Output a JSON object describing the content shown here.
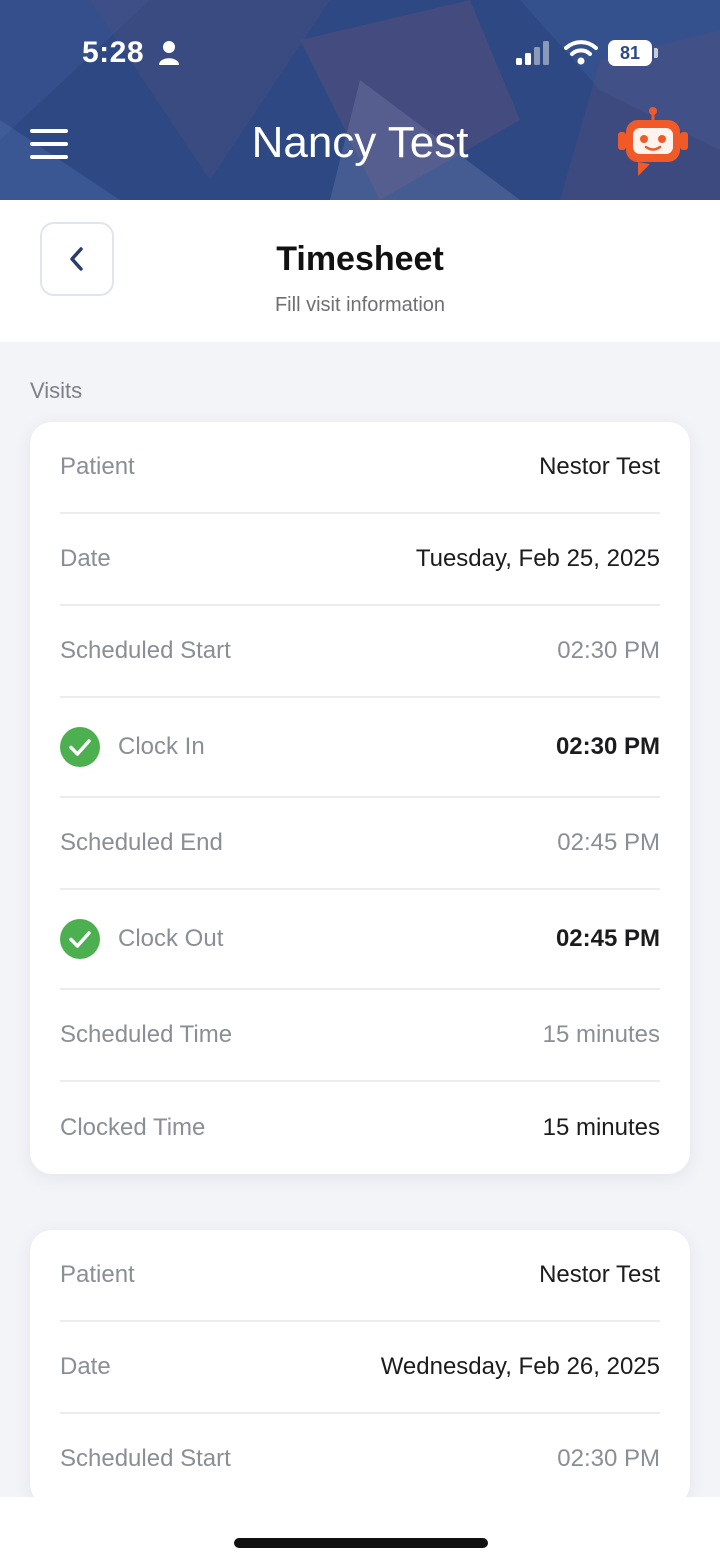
{
  "status_bar": {
    "time": "5:28",
    "battery": "81",
    "icons": [
      "person-icon",
      "signal-icon",
      "wifi-icon",
      "battery-icon"
    ]
  },
  "header": {
    "title": "Nancy Test",
    "menu_icon": "hamburger-menu-icon",
    "assistant_icon": "robot-assistant-icon"
  },
  "subheader": {
    "title": "Timesheet",
    "subtitle": "Fill visit information",
    "back_icon": "chevron-left-icon"
  },
  "visits": {
    "section_label": "Visits",
    "cards": [
      {
        "patient_label": "Patient",
        "patient": "Nestor Test",
        "date_label": "Date",
        "date": "Tuesday, Feb 25, 2025",
        "scheduled_start_label": "Scheduled Start",
        "scheduled_start": "02:30 PM",
        "clock_in_label": "Clock In",
        "clock_in": "02:30 PM",
        "scheduled_end_label": "Scheduled End",
        "scheduled_end": "02:45 PM",
        "clock_out_label": "Clock Out",
        "clock_out": "02:45 PM",
        "scheduled_time_label": "Scheduled Time",
        "scheduled_time": "15 minutes",
        "clocked_time_label": "Clocked Time",
        "clocked_time": "15 minutes"
      },
      {
        "patient_label": "Patient",
        "patient": "Nestor Test",
        "date_label": "Date",
        "date": "Wednesday, Feb 26, 2025",
        "scheduled_start_label": "Scheduled Start",
        "scheduled_start": "02:30 PM"
      }
    ]
  },
  "colors": {
    "header_bg": "#2e4a86",
    "check_green": "#4caf50",
    "robot_orange": "#f05a28"
  }
}
